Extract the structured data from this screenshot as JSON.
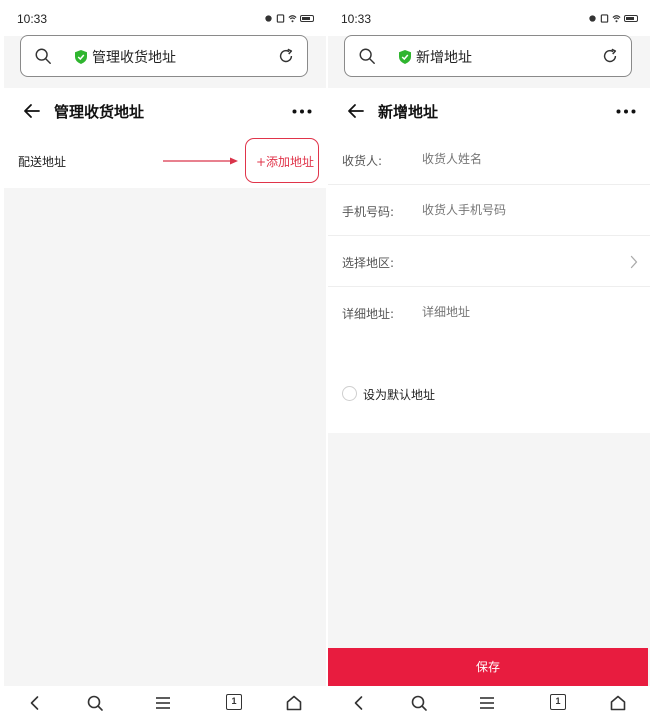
{
  "status_bar": {
    "time": "10:33"
  },
  "left_screen": {
    "url_bar": {
      "text": "管理收货地址"
    },
    "header": {
      "title": "管理收货地址"
    },
    "address_row": {
      "label": "配送地址",
      "add_link": "+添加地址"
    },
    "bottom_nav": {
      "tab_count": "1"
    }
  },
  "right_screen": {
    "url_bar": {
      "text": "新增地址"
    },
    "header": {
      "title": "新增地址"
    },
    "form": {
      "rows": [
        {
          "label": "收货人:",
          "placeholder": "收货人姓名"
        },
        {
          "label": "手机号码:",
          "placeholder": "收货人手机号码"
        },
        {
          "label": "选择地区:",
          "placeholder": ""
        },
        {
          "label": "详细地址:",
          "placeholder": "详细地址"
        }
      ]
    },
    "default_option": {
      "label": "设为默认地址"
    },
    "save_button": {
      "label": "保存"
    },
    "bottom_nav": {
      "tab_count": "1"
    }
  },
  "icons": {
    "search": "search-icon",
    "shield": "shield-icon",
    "reload": "reload-icon",
    "back": "back-arrow-icon",
    "more": "more-icon",
    "chevron": "chevron-right-icon",
    "nav_back": "chevron-left-icon",
    "nav_menu": "menu-icon",
    "nav_home": "home-icon"
  },
  "colors": {
    "accent": "#e0344a",
    "save_button": "#e81c3f",
    "shield": "#2fb52f"
  }
}
